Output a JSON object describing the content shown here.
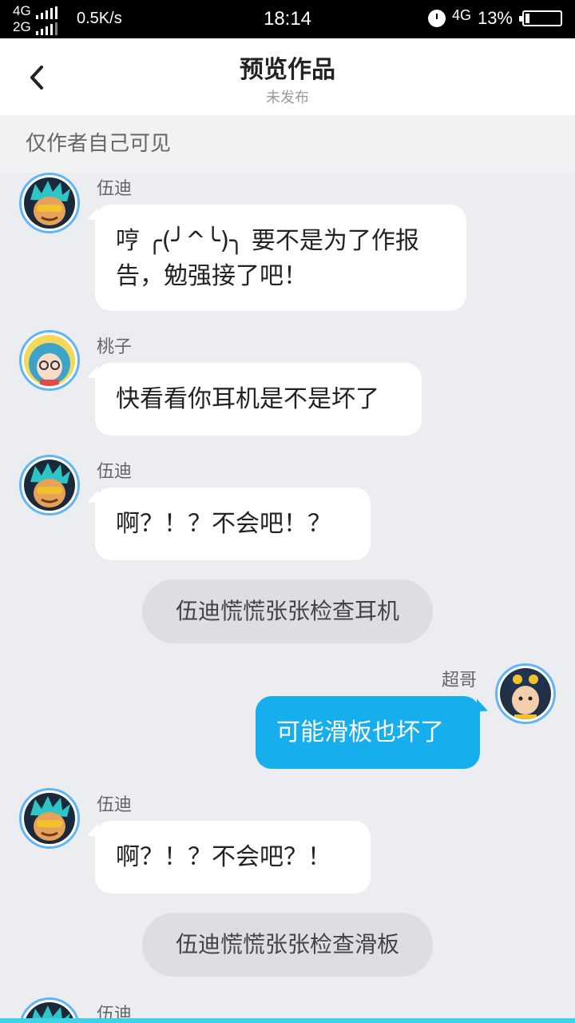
{
  "status_bar": {
    "net1": "4G",
    "net2": "2G",
    "speed": "0.5K/s",
    "time": "18:14",
    "net_right": "4G",
    "battery": "13%",
    "battery_level": 0.13
  },
  "header": {
    "title": "预览作品",
    "subtitle": "未发布"
  },
  "notice": "仅作者自己可见",
  "messages": [
    {
      "name": "伍迪",
      "text": "哼 ╭(╯^╰)╮ 要不是为了作报告，勉强接了吧！"
    },
    {
      "name": "桃子",
      "text": "快看看你耳机是不是坏了"
    },
    {
      "name": "伍迪",
      "text": "啊？！？不会吧！？"
    },
    {
      "narration": "伍迪慌慌张张检查耳机"
    },
    {
      "name": "超哥",
      "text": "可能滑板也坏了"
    },
    {
      "name": "伍迪",
      "text": "啊？！？不会吧？！"
    },
    {
      "narration": "伍迪慌慌张张检查滑板"
    },
    {
      "name": "伍迪"
    }
  ],
  "colors": {
    "accent_blue": "#17aeee",
    "avatar_ring": "#61b5f3",
    "background": "#ebedf0"
  }
}
